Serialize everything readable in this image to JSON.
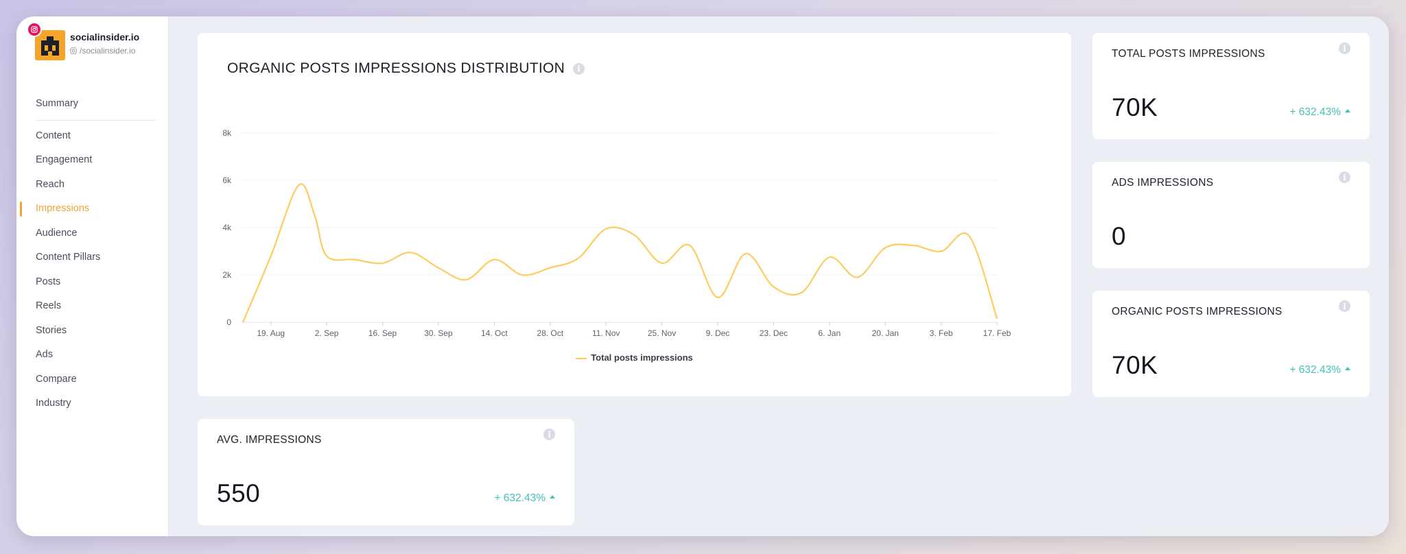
{
  "profile": {
    "name": "socialinsider.io",
    "handle": "/socialinsider.io",
    "network_icon": "instagram-icon"
  },
  "nav": {
    "items": [
      {
        "label": "Summary"
      },
      {
        "label": "Content"
      },
      {
        "label": "Engagement"
      },
      {
        "label": "Reach"
      },
      {
        "label": "Impressions",
        "active": true
      },
      {
        "label": "Audience"
      },
      {
        "label": "Content Pillars"
      },
      {
        "label": "Posts"
      },
      {
        "label": "Reels"
      },
      {
        "label": "Stories"
      },
      {
        "label": "Ads"
      },
      {
        "label": "Compare"
      },
      {
        "label": "Industry"
      }
    ]
  },
  "colors": {
    "accent": "#f2a33a",
    "line": "#ffcb5f",
    "positive": "#46c0b9"
  },
  "chart_data": {
    "type": "line",
    "title": "ORGANIC POSTS IMPRESSIONS DISTRIBUTION",
    "xlabel": "",
    "ylabel": "",
    "ylim": [
      0,
      8000
    ],
    "y_ticks": [
      "0",
      "2k",
      "4k",
      "6k",
      "8k"
    ],
    "x_ticks": [
      "19. Aug",
      "2. Sep",
      "16. Sep",
      "30. Sep",
      "14. Oct",
      "28. Oct",
      "11. Nov",
      "25. Nov",
      "9. Dec",
      "23. Dec",
      "6. Jan",
      "20. Jan",
      "3. Feb",
      "17. Feb"
    ],
    "grid": true,
    "legend": "bottom",
    "series": [
      {
        "name": "Total posts impressions",
        "x": [
          "2023-08-12",
          "2023-08-19",
          "2023-08-26",
          "2023-08-30",
          "2023-09-02",
          "2023-09-09",
          "2023-09-16",
          "2023-09-23",
          "2023-09-30",
          "2023-10-07",
          "2023-10-14",
          "2023-10-21",
          "2023-10-28",
          "2023-11-04",
          "2023-11-11",
          "2023-11-18",
          "2023-11-25",
          "2023-12-02",
          "2023-12-09",
          "2023-12-16",
          "2023-12-23",
          "2023-12-30",
          "2024-01-06",
          "2024-01-13",
          "2024-01-20",
          "2024-01-27",
          "2024-02-03",
          "2024-02-10",
          "2024-02-17"
        ],
        "values": [
          0,
          2800,
          5800,
          4500,
          2800,
          2650,
          2500,
          2950,
          2300,
          1800,
          2650,
          2000,
          2300,
          2700,
          3950,
          3700,
          2500,
          3250,
          1050,
          2900,
          1500,
          1250,
          2750,
          1900,
          3150,
          3250,
          3000,
          3650,
          150
        ]
      }
    ]
  },
  "stats": {
    "total": {
      "title": "TOTAL POSTS IMPRESSIONS",
      "value": "70K",
      "change": "+ 632.43%"
    },
    "ads": {
      "title": "ADS IMPRESSIONS",
      "value": "0"
    },
    "organic": {
      "title": "ORGANIC POSTS IMPRESSIONS",
      "value": "70K",
      "change": "+ 632.43%"
    },
    "avg": {
      "title": "AVG. IMPRESSIONS",
      "value": "550",
      "change": "+ 632.43%"
    }
  }
}
